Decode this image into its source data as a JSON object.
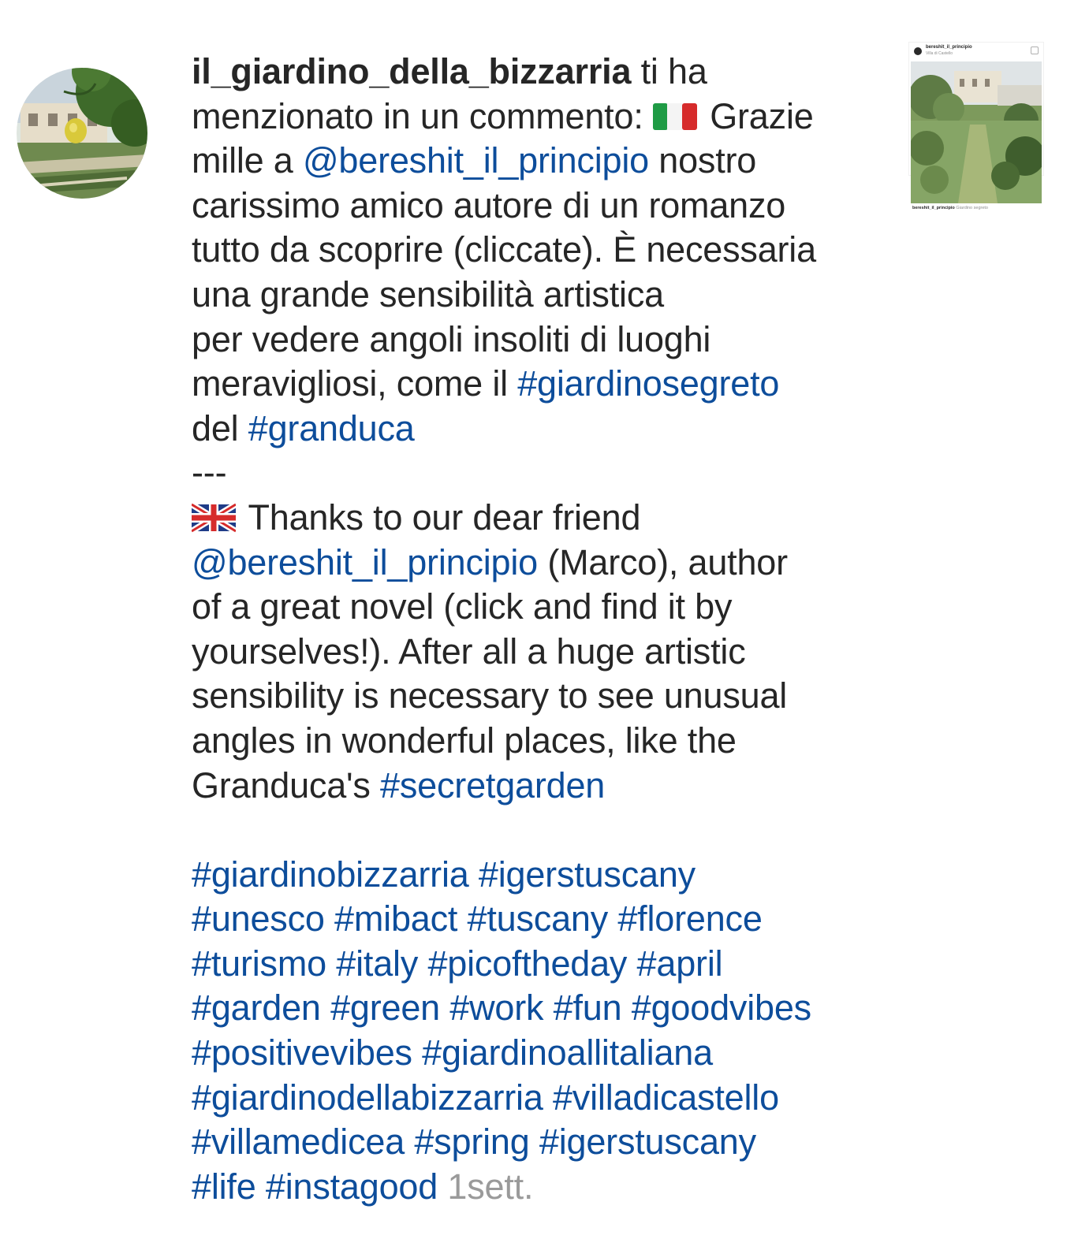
{
  "notification": {
    "username": "il_giardino_della_bizzarria",
    "action": " ti ha",
    "lines": [
      [
        {
          "t": "menzionato in un commento: "
        },
        {
          "flag": "italy-flag"
        },
        {
          "t": " Grazie"
        }
      ],
      [
        {
          "t": "mille a "
        },
        {
          "link": "@bereshit_il_principio"
        },
        {
          "t": " nostro"
        }
      ],
      [
        {
          "t": "carissimo amico autore di un romanzo"
        }
      ],
      [
        {
          "t": "tutto da scoprire (cliccate). È necessaria"
        }
      ],
      [
        {
          "t": "una grande sensibilità artistica"
        }
      ],
      [
        {
          "t": "per vedere angoli insoliti di luoghi"
        }
      ],
      [
        {
          "t": "meravigliosi, come il "
        },
        {
          "link": "#giardinosegreto"
        }
      ],
      [
        {
          "t": "del "
        },
        {
          "link": "#granduca"
        }
      ],
      [
        {
          "t": "---"
        }
      ],
      [
        {
          "flag": "uk-flag"
        },
        {
          "t": " Thanks to our dear friend"
        }
      ],
      [
        {
          "link": "@bereshit_il_principio"
        },
        {
          "t": " (Marco), author"
        }
      ],
      [
        {
          "t": "of a great novel (click and find it by"
        }
      ],
      [
        {
          "t": "yourselves!). After all a huge artistic"
        }
      ],
      [
        {
          "t": "sensibility is necessary to see unusual"
        }
      ],
      [
        {
          "t": "angles in wonderful places, like the"
        }
      ],
      [
        {
          "t": "Granduca's "
        },
        {
          "link": "#secretgarden"
        }
      ],
      [],
      [
        {
          "link": "#giardinobizzarria"
        },
        {
          "t": " "
        },
        {
          "link": "#igerstuscany"
        }
      ],
      [
        {
          "link": "#unesco"
        },
        {
          "t": " "
        },
        {
          "link": "#mibact"
        },
        {
          "t": " "
        },
        {
          "link": "#tuscany"
        },
        {
          "t": " "
        },
        {
          "link": "#florence"
        }
      ],
      [
        {
          "link": "#turismo"
        },
        {
          "t": " "
        },
        {
          "link": "#italy"
        },
        {
          "t": " "
        },
        {
          "link": "#picoftheday"
        },
        {
          "t": " "
        },
        {
          "link": "#april"
        }
      ],
      [
        {
          "link": "#garden"
        },
        {
          "t": " "
        },
        {
          "link": "#green"
        },
        {
          "t": " "
        },
        {
          "link": "#work"
        },
        {
          "t": " "
        },
        {
          "link": "#fun"
        },
        {
          "t": " "
        },
        {
          "link": "#goodvibes"
        }
      ],
      [
        {
          "link": "#positivevibes"
        },
        {
          "t": " "
        },
        {
          "link": "#giardinoallitaliana"
        }
      ],
      [
        {
          "link": "#giardinodellabizzarria"
        },
        {
          "t": " "
        },
        {
          "link": "#villadicastello"
        }
      ],
      [
        {
          "link": "#villamedicea"
        },
        {
          "t": " "
        },
        {
          "link": "#spring"
        },
        {
          "t": " "
        },
        {
          "link": "#igerstuscany"
        }
      ],
      [
        {
          "link": "#life"
        },
        {
          "t": " "
        },
        {
          "link": "#instagood"
        },
        {
          "t": " "
        },
        {
          "ts": "1sett."
        }
      ]
    ]
  },
  "thumbnail": {
    "username": "bereshit_il_principio",
    "location": "Villa di Castello",
    "caption_user": "bereshit_il_principio",
    "caption_text": " Giardino segreto"
  },
  "colors": {
    "link": "#0d4d9b",
    "text": "#262626",
    "timestamp": "#9a9a9a"
  },
  "icons": {
    "avatar": "avatar-garden-photo",
    "thumbnail": "post-thumbnail-photo"
  }
}
